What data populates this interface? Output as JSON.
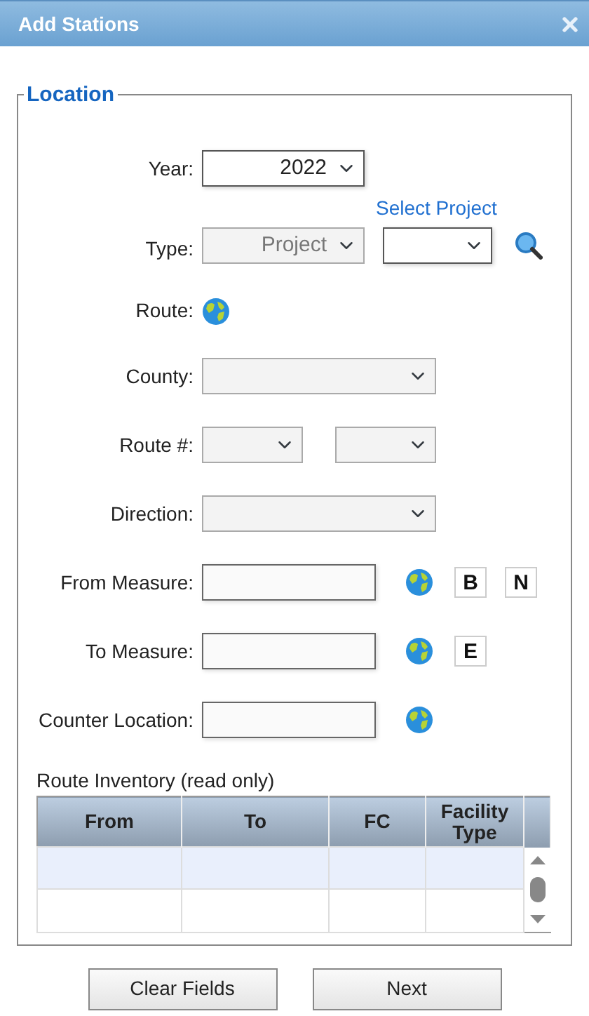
{
  "window": {
    "title": "Add Stations"
  },
  "location": {
    "legend": "Location",
    "fields": [
      {
        "kind": "select",
        "label": "Year:",
        "value": "2022",
        "disabled": false
      },
      {
        "kind": "type",
        "label": "Type:",
        "value": "Project",
        "disabled": true,
        "link": "Select Project"
      },
      {
        "kind": "globe",
        "label": "Route:"
      },
      {
        "kind": "select",
        "label": "County:",
        "disabled": true
      },
      {
        "kind": "route",
        "label": "Route #:",
        "disabled": true
      },
      {
        "kind": "select",
        "label": "Direction:",
        "disabled": true
      },
      {
        "kind": "measure",
        "label": "From Measure:",
        "buttons": [
          "B",
          "N"
        ]
      },
      {
        "kind": "measure",
        "label": "To Measure:",
        "buttons": [
          "E"
        ]
      },
      {
        "kind": "measure",
        "label": "Counter Location:"
      }
    ],
    "inventory": {
      "title": "Route Inventory (read only)",
      "columns": [
        "From",
        "To",
        "FC",
        "Facility Type"
      ]
    }
  },
  "buttons": [
    "Clear Fields",
    "Next"
  ]
}
